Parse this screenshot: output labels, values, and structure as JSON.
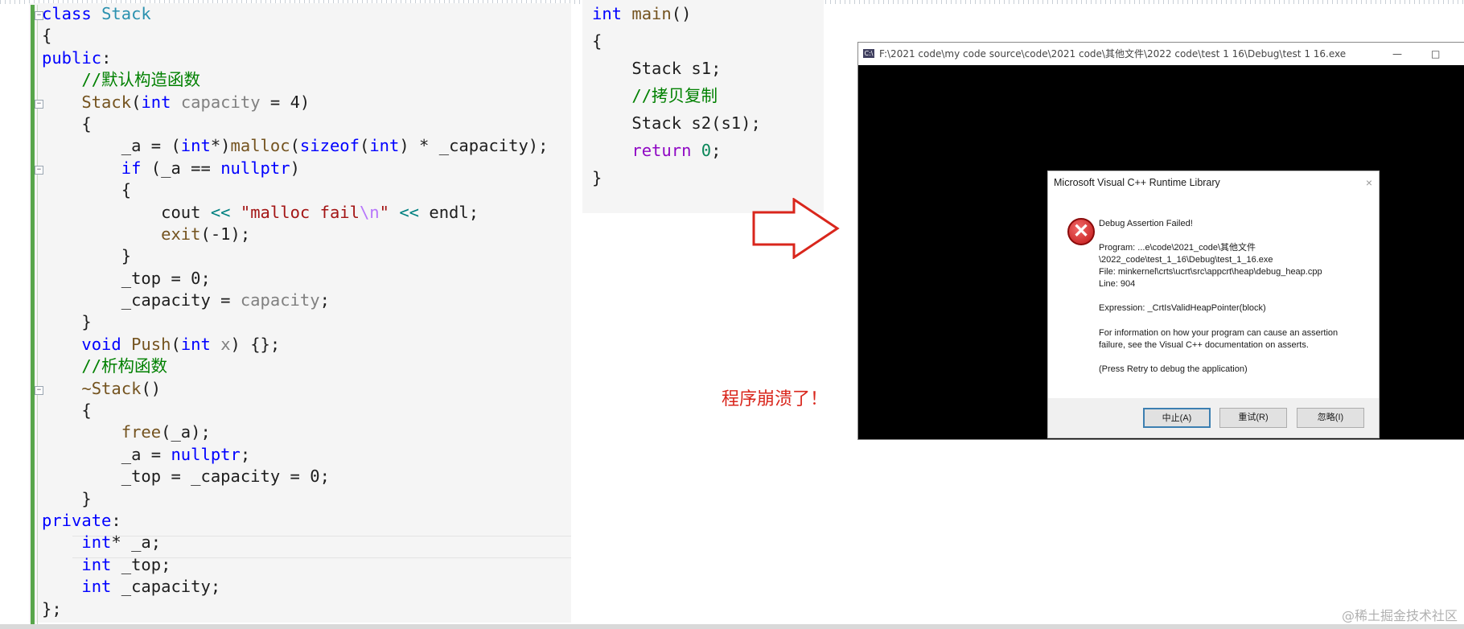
{
  "editor_left": {
    "lines": [
      [
        {
          "t": "class ",
          "c": "kw"
        },
        {
          "t": "Stack",
          "c": "ty"
        }
      ],
      [
        {
          "t": "{",
          "c": ""
        }
      ],
      [
        {
          "t": "public",
          "c": "kw"
        },
        {
          "t": ":",
          "c": ""
        }
      ],
      [
        {
          "t": "    ",
          "c": ""
        },
        {
          "t": "//默认构造函数",
          "c": "cm"
        }
      ],
      [
        {
          "t": "    ",
          "c": ""
        },
        {
          "t": "Stack",
          "c": "fn"
        },
        {
          "t": "(",
          "c": ""
        },
        {
          "t": "int ",
          "c": "kw"
        },
        {
          "t": "capacity",
          "c": "pm"
        },
        {
          "t": " = 4)",
          "c": ""
        }
      ],
      [
        {
          "t": "    {",
          "c": ""
        }
      ],
      [
        {
          "t": "        _a = (",
          "c": ""
        },
        {
          "t": "int",
          "c": "kw"
        },
        {
          "t": "*)",
          "c": ""
        },
        {
          "t": "malloc",
          "c": "fn"
        },
        {
          "t": "(",
          "c": ""
        },
        {
          "t": "sizeof",
          "c": "kw"
        },
        {
          "t": "(",
          "c": ""
        },
        {
          "t": "int",
          "c": "kw"
        },
        {
          "t": ") * _capacity);",
          "c": ""
        }
      ],
      [
        {
          "t": "        ",
          "c": ""
        },
        {
          "t": "if",
          "c": "kw"
        },
        {
          "t": " (_a == ",
          "c": ""
        },
        {
          "t": "nullptr",
          "c": "kw"
        },
        {
          "t": ")",
          "c": ""
        }
      ],
      [
        {
          "t": "        {",
          "c": ""
        }
      ],
      [
        {
          "t": "            cout ",
          "c": ""
        },
        {
          "t": "<<",
          "c": "op"
        },
        {
          "t": " ",
          "c": ""
        },
        {
          "t": "\"malloc fail",
          "c": "st"
        },
        {
          "t": "\\n",
          "c": "es"
        },
        {
          "t": "\"",
          "c": "st"
        },
        {
          "t": " ",
          "c": ""
        },
        {
          "t": "<<",
          "c": "op"
        },
        {
          "t": " endl;",
          "c": ""
        }
      ],
      [
        {
          "t": "            ",
          "c": ""
        },
        {
          "t": "exit",
          "c": "fn"
        },
        {
          "t": "(-1);",
          "c": ""
        }
      ],
      [
        {
          "t": "        }",
          "c": ""
        }
      ],
      [
        {
          "t": "        _top = 0;",
          "c": ""
        }
      ],
      [
        {
          "t": "        _capacity = ",
          "c": ""
        },
        {
          "t": "capacity",
          "c": "pm"
        },
        {
          "t": ";",
          "c": ""
        }
      ],
      [
        {
          "t": "    }",
          "c": ""
        }
      ],
      [
        {
          "t": "    ",
          "c": ""
        },
        {
          "t": "void ",
          "c": "kw"
        },
        {
          "t": "Push",
          "c": "fn"
        },
        {
          "t": "(",
          "c": ""
        },
        {
          "t": "int ",
          "c": "kw"
        },
        {
          "t": "x",
          "c": "pm"
        },
        {
          "t": ") {};",
          "c": ""
        }
      ],
      [
        {
          "t": "    ",
          "c": ""
        },
        {
          "t": "//析构函数",
          "c": "cm"
        }
      ],
      [
        {
          "t": "    ",
          "c": ""
        },
        {
          "t": "~Stack",
          "c": "fn"
        },
        {
          "t": "()",
          "c": ""
        }
      ],
      [
        {
          "t": "    {",
          "c": ""
        }
      ],
      [
        {
          "t": "        ",
          "c": ""
        },
        {
          "t": "free",
          "c": "fn"
        },
        {
          "t": "(_a);",
          "c": ""
        }
      ],
      [
        {
          "t": "        _a = ",
          "c": ""
        },
        {
          "t": "nullptr",
          "c": "kw"
        },
        {
          "t": ";",
          "c": ""
        }
      ],
      [
        {
          "t": "        _top = _capacity = 0;",
          "c": ""
        }
      ],
      [
        {
          "t": "    }",
          "c": ""
        }
      ],
      [
        {
          "t": "private",
          "c": "kw"
        },
        {
          "t": ":",
          "c": ""
        }
      ],
      [
        {
          "t": "    ",
          "c": ""
        },
        {
          "t": "int",
          "c": "kw"
        },
        {
          "t": "* _a;",
          "c": ""
        }
      ],
      [
        {
          "t": "    ",
          "c": ""
        },
        {
          "t": "int",
          "c": "kw"
        },
        {
          "t": " _top;",
          "c": ""
        }
      ],
      [
        {
          "t": "    ",
          "c": ""
        },
        {
          "t": "int",
          "c": "kw"
        },
        {
          "t": " _capacity;",
          "c": ""
        }
      ],
      [
        {
          "t": "};",
          "c": ""
        }
      ]
    ]
  },
  "editor_main": {
    "lines": [
      [
        {
          "t": "int ",
          "c": "kw"
        },
        {
          "t": "main",
          "c": "fn"
        },
        {
          "t": "()",
          "c": ""
        }
      ],
      [
        {
          "t": "{",
          "c": ""
        }
      ],
      [
        {
          "t": "    Stack s1;",
          "c": ""
        }
      ],
      [
        {
          "t": "    ",
          "c": ""
        },
        {
          "t": "//拷贝复制",
          "c": "cm"
        }
      ],
      [
        {
          "t": "    Stack s2(s1);",
          "c": ""
        }
      ],
      [
        {
          "t": "    ",
          "c": ""
        },
        {
          "t": "return ",
          "c": "ctl"
        },
        {
          "t": "0",
          "c": "num"
        },
        {
          "t": ";",
          "c": ""
        }
      ],
      [
        {
          "t": "}",
          "c": ""
        }
      ]
    ]
  },
  "annotation": {
    "crash_text": "程序崩溃了！"
  },
  "console_window": {
    "title": "F:\\2021 code\\my code source\\code\\2021 code\\其他文件\\2022 code\\test 1 16\\Debug\\test 1 16.exe",
    "icon_label": "C:\\",
    "minimize_glyph": "—",
    "maximize_glyph": "□"
  },
  "dialog": {
    "title": "Microsoft Visual C++ Runtime Library",
    "close_glyph": "×",
    "icon_glyph": "✕",
    "heading": "Debug Assertion Failed!",
    "program": "Program: ...e\\code\\2021_code\\其他文件\n\\2022_code\\test_1_16\\Debug\\test_1_16.exe",
    "file": "File: minkernel\\crts\\ucrt\\src\\appcrt\\heap\\debug_heap.cpp",
    "line": "Line: 904",
    "expression": "Expression: _CrtIsValidHeapPointer(block)",
    "info": "For information on how your program can cause an assertion\nfailure, see the Visual C++ documentation on asserts.",
    "retry_hint": "(Press Retry to debug the application)",
    "buttons": {
      "abort": "中止(A)",
      "retry": "重试(R)",
      "ignore": "忽略(I)"
    }
  },
  "watermark": "@稀土掘金技术社区"
}
